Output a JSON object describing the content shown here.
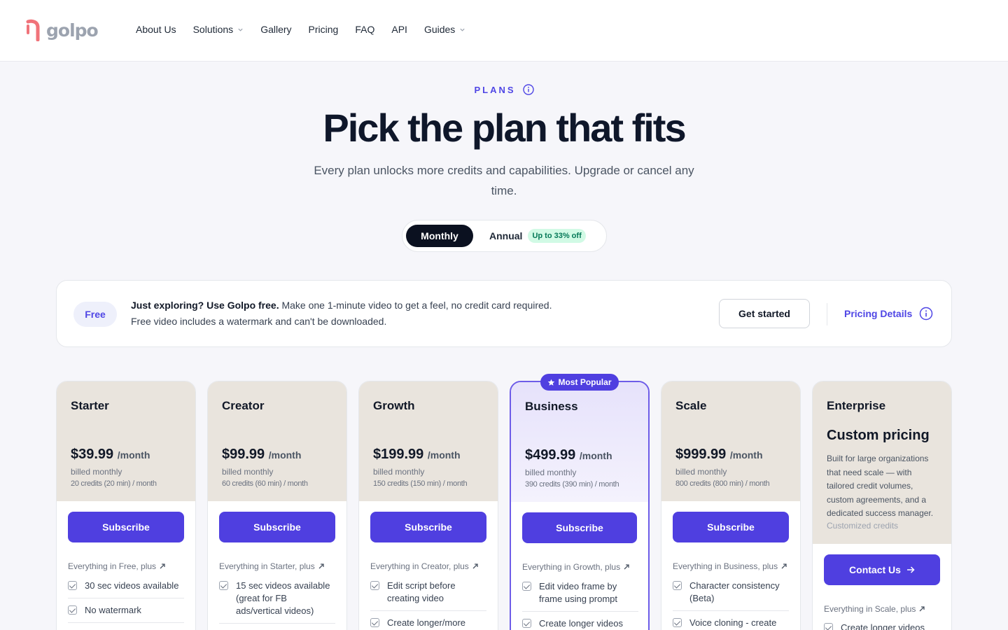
{
  "nav": {
    "brand": "golpo",
    "items": [
      {
        "label": "About Us",
        "dropdown": false
      },
      {
        "label": "Solutions",
        "dropdown": true
      },
      {
        "label": "Gallery",
        "dropdown": false
      },
      {
        "label": "Pricing",
        "dropdown": false
      },
      {
        "label": "FAQ",
        "dropdown": false
      },
      {
        "label": "API",
        "dropdown": false
      },
      {
        "label": "Guides",
        "dropdown": true
      }
    ]
  },
  "hero": {
    "eyebrow": "PLANS",
    "title": "Pick the plan that fits",
    "subtitle": "Every plan unlocks more credits and capabilities. Upgrade or cancel any time."
  },
  "billing_toggle": {
    "monthly": "Monthly",
    "annual": "Annual",
    "annual_badge": "Up to 33% off",
    "selected": "Monthly"
  },
  "free_banner": {
    "pill": "Free",
    "headline": "Just exploring? Use Golpo free.",
    "line1_rest": " Make one 1-minute video to get a feel, no credit card required.",
    "line2": "Free video includes a watermark and can't be downloaded.",
    "cta": "Get started",
    "details_link": "Pricing Details"
  },
  "plans": [
    {
      "name": "Starter",
      "price": "$39.99",
      "per": "/month",
      "billed": "billed monthly",
      "credits": "20 credits (20 min) / month",
      "cta": "Subscribe",
      "everything": "Everything in Free, plus",
      "features": [
        "30 sec videos available",
        "No watermark"
      ]
    },
    {
      "name": "Creator",
      "price": "$99.99",
      "per": "/month",
      "billed": "billed monthly",
      "credits": "60 credits (60 min) / month",
      "cta": "Subscribe",
      "everything": "Everything in Starter, plus",
      "features": [
        "15 sec videos available (great for FB ads/vertical videos)"
      ]
    },
    {
      "name": "Growth",
      "price": "$199.99",
      "per": "/month",
      "billed": "billed monthly",
      "credits": "150 credits (150 min) / month",
      "cta": "Subscribe",
      "everything": "Everything in Creator, plus",
      "features": [
        "Edit script before creating video",
        "Create longer/more"
      ]
    },
    {
      "name": "Business",
      "price": "$499.99",
      "per": "/month",
      "billed": "billed monthly",
      "credits": "390 credits (390 min) / month",
      "cta": "Subscribe",
      "badge": "Most Popular",
      "everything": "Everything in Growth, plus",
      "features": [
        "Edit video frame by frame using prompt",
        "Create longer videos (up"
      ]
    },
    {
      "name": "Scale",
      "price": "$999.99",
      "per": "/month",
      "billed": "billed monthly",
      "credits": "800 credits (800 min) / month",
      "cta": "Subscribe",
      "everything": "Everything in Business, plus",
      "features": [
        "Character consistency (Beta)",
        "Voice cloning - create"
      ]
    },
    {
      "name": "Enterprise",
      "price": "Custom pricing",
      "description": "Built for large organizations that need scale — with tailored credit volumes, custom agreements, and a dedicated success manager.",
      "credits": "Customized credits",
      "cta": "Contact Us",
      "everything": "Everything in Scale, plus",
      "features": [
        "Create longer videos (up"
      ]
    }
  ],
  "colors": {
    "accent": "#4f3fe0",
    "eyebrow": "#4f46e5",
    "card_head": "#e9e4dd",
    "popular_border": "#6d5ce8",
    "toggle_active": "#0b1120",
    "badge_green_bg": "#d1fae5",
    "badge_green_fg": "#047857"
  }
}
